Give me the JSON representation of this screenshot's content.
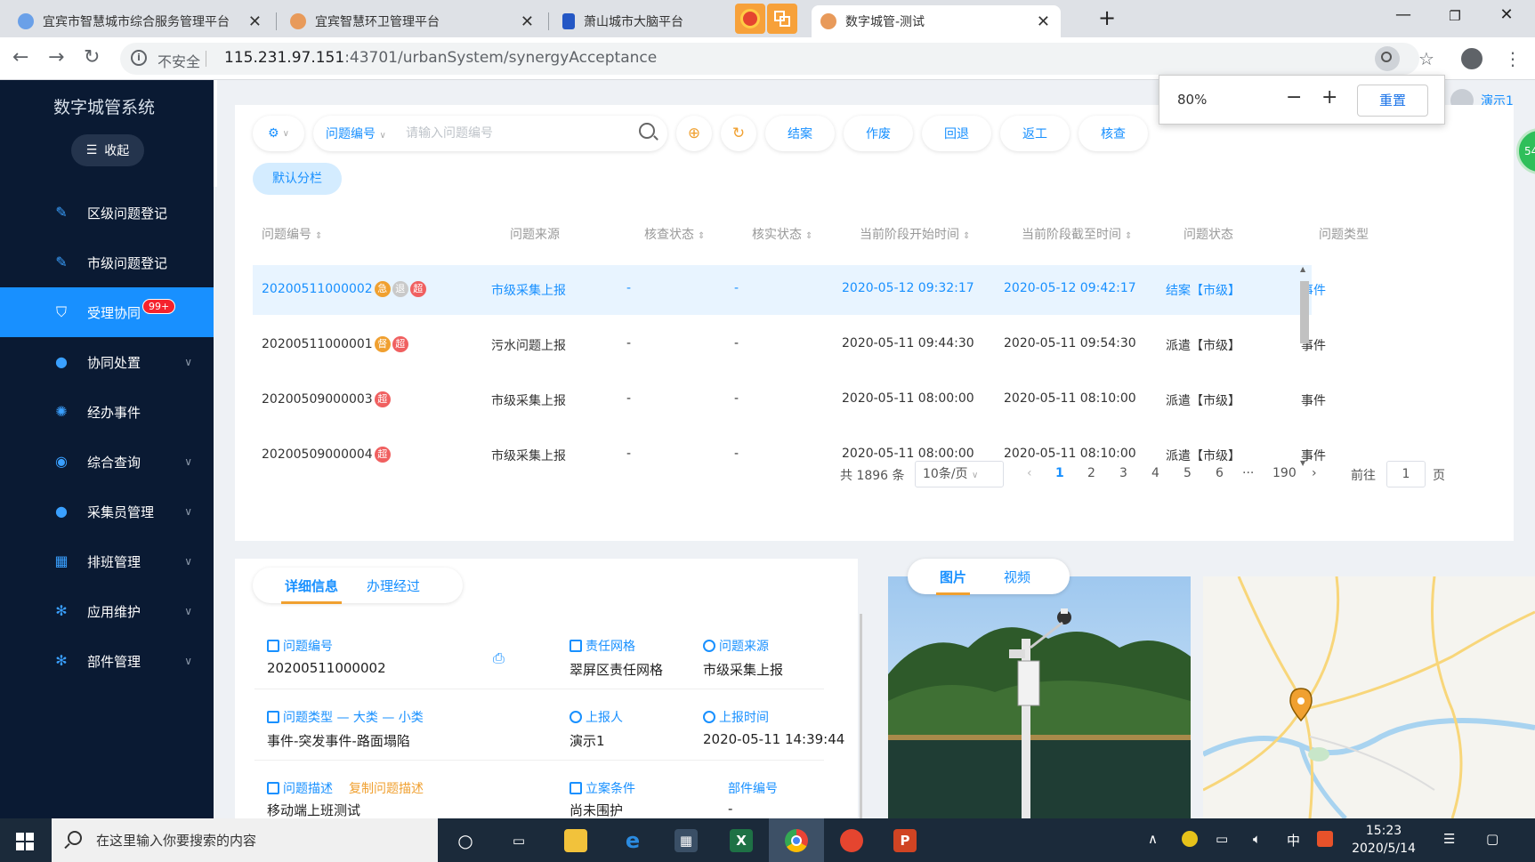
{
  "browser": {
    "tabs": [
      {
        "title": "宜宾市智慧城市综合服务管理平台"
      },
      {
        "title": "宜宾智慧环卫管理平台"
      },
      {
        "title": "萧山城市大脑平台"
      },
      {
        "title": "数字城管-测试"
      }
    ],
    "insecure_label": "不安全",
    "url_host": "115.231.97.151",
    "url_path": ":43701/urbanSystem/synergyAcceptance"
  },
  "zoom": {
    "value": "80%",
    "reset_label": "重置"
  },
  "sidebar": {
    "title": "数字城管系统",
    "collapse_label": "收起",
    "items": [
      {
        "label": "区级问题登记",
        "icon": "edit-icon"
      },
      {
        "label": "市级问题登记",
        "icon": "edit-icon"
      },
      {
        "label": "受理协同",
        "icon": "shield-icon",
        "badge": "99+"
      },
      {
        "label": "协同处置",
        "icon": "user-icon"
      },
      {
        "label": "经办事件",
        "icon": "gear-icon"
      },
      {
        "label": "综合查询",
        "icon": "search-icon"
      },
      {
        "label": "采集员管理",
        "icon": "user-group-icon"
      },
      {
        "label": "排班管理",
        "icon": "calendar-icon"
      },
      {
        "label": "应用维护",
        "icon": "settings-icon"
      },
      {
        "label": "部件管理",
        "icon": "settings-icon"
      }
    ]
  },
  "user": {
    "name": "演示1"
  },
  "green_badge": "54",
  "toolbar": {
    "search_field": "问题编号",
    "search_placeholder": "请输入问题编号",
    "actions": [
      "结案",
      "作废",
      "回退",
      "返工",
      "核查"
    ],
    "default_group": "默认分栏"
  },
  "table": {
    "headers": [
      "问题编号",
      "问题来源",
      "核查状态",
      "核实状态",
      "当前阶段开始时间",
      "当前阶段截至时间",
      "问题状态",
      "问题类型"
    ],
    "rows": [
      {
        "id": "20200511000002",
        "tags": [
          "急",
          "退",
          "超"
        ],
        "source": "市级采集上报",
        "check": "-",
        "verify": "-",
        "start": "2020-05-12 09:32:17",
        "end": "2020-05-12 09:42:17",
        "status": "结案【市级】",
        "type": "事件"
      },
      {
        "id": "20200511000001",
        "tags": [
          "督",
          "超"
        ],
        "source": "污水问题上报",
        "check": "-",
        "verify": "-",
        "start": "2020-05-11 09:44:30",
        "end": "2020-05-11 09:54:30",
        "status": "派遣【市级】",
        "type": "事件"
      },
      {
        "id": "20200509000003",
        "tags": [
          "超"
        ],
        "source": "市级采集上报",
        "check": "-",
        "verify": "-",
        "start": "2020-05-11 08:00:00",
        "end": "2020-05-11 08:10:00",
        "status": "派遣【市级】",
        "type": "事件"
      },
      {
        "id": "20200509000004",
        "tags": [
          "超"
        ],
        "source": "市级采集上报",
        "check": "-",
        "verify": "-",
        "start": "2020-05-11 08:00:00",
        "end": "2020-05-11 08:10:00",
        "status": "派遣【市级】",
        "type": "事件"
      }
    ]
  },
  "pager": {
    "total": "共 1896 条",
    "page_size": "10条/页",
    "pages": [
      "1",
      "2",
      "3",
      "4",
      "5",
      "6",
      "···",
      "190"
    ],
    "current": "1",
    "goto_label": "前往",
    "goto_value": "1",
    "page_unit": "页"
  },
  "detail": {
    "tabs": [
      "详细信息",
      "办理经过"
    ],
    "fields": {
      "id_label": "问题编号",
      "id_value": "20200511000002",
      "grid_label": "责任网格",
      "grid_value": "翠屏区责任网格",
      "source_label": "问题来源",
      "source_value": "市级采集上报",
      "type_label": "问题类型 — 大类 — 小类",
      "type_value": "事件-突发事件-路面塌陷",
      "reporter_label": "上报人",
      "reporter_value": "演示1",
      "time_label": "上报时间",
      "time_value": "2020-05-11 14:39:44",
      "desc_label": "问题描述",
      "copy_label": "复制问题描述",
      "desc_value": "移动端上班测试",
      "case_label": "立案条件",
      "case_value": "尚未围护",
      "part_label": "部件编号",
      "part_value": "-"
    }
  },
  "media": {
    "tabs": [
      "图片",
      "视频"
    ]
  },
  "taskbar": {
    "search_placeholder": "在这里输入你要搜索的内容",
    "ime": "中",
    "time": "15:23",
    "date": "2020/5/14"
  }
}
